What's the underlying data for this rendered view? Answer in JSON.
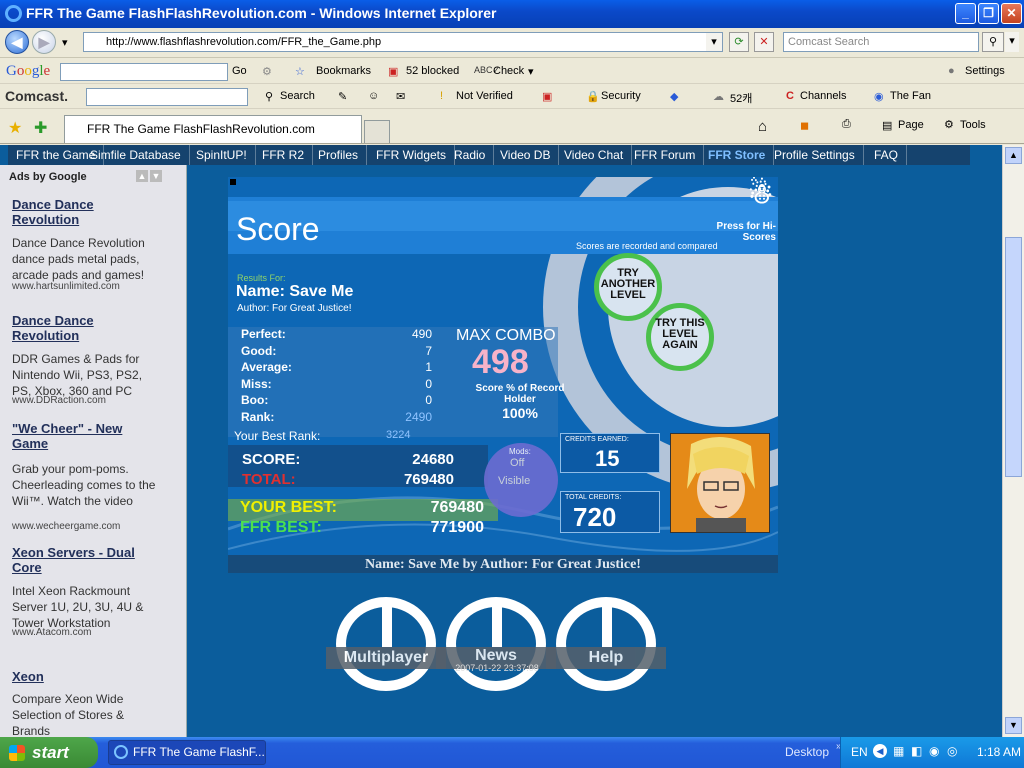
{
  "window": {
    "title": "FFR The Game FlashFlashRevolution.com - Windows Internet Explorer"
  },
  "addressbar": {
    "url": "http://www.flashflashrevolution.com/FFR_the_Game.php",
    "search_placeholder": "Comcast Search"
  },
  "google_toolbar": {
    "go_label": "Go",
    "bookmarks_label": "Bookmarks",
    "blocked_label": "52 blocked",
    "check_label": "Check",
    "settings_label": "Settings"
  },
  "comcast_toolbar": {
    "search_label": "Search",
    "verified_label": "Not Verified",
    "security_label": "Security",
    "count_label": "52캐",
    "channels_label": "Channels",
    "fan_label": "The Fan"
  },
  "tabs": {
    "active_tab": "FFR The Game FlashFlashRevolution.com",
    "page_label": "Page",
    "tools_label": "Tools"
  },
  "site_nav": [
    "FFR the Game",
    "Simfile Database",
    "SpinItUP!",
    "FFR R2",
    "Profiles",
    "FFR Widgets",
    "Radio",
    "Video DB",
    "Video Chat",
    "FFR Forum",
    "FFR Store",
    "Profile Settings",
    "FAQ"
  ],
  "ads": {
    "header": "Ads by Google",
    "items": [
      {
        "title": "Dance Dance Revolution",
        "text": "Dance Dance Revolution dance pads metal pads, arcade pads and games!",
        "url": "www.hartsunlimited.com"
      },
      {
        "title": "Dance Dance Revolution",
        "text": "DDR Games & Pads for Nintendo Wii, PS3, PS2, PS, Xbox, 360 and PC",
        "url": "www.DDRaction.com"
      },
      {
        "title": "\"We Cheer\" - New Game",
        "text": "Grab your pom-poms. Cheerleading comes to the Wii™. Watch the video",
        "url": "www.wecheergame.com"
      },
      {
        "title": "Xeon Servers - Dual Core",
        "text": "Intel Xeon Rackmount Server 1U, 2U, 3U, 4U & Tower Workstation",
        "url": "www.Atacom.com"
      },
      {
        "title": "Xeon",
        "text": "Compare Xeon Wide Selection of Stores & Brands",
        "url": ""
      }
    ]
  },
  "game": {
    "heading": "Score",
    "hiscore_text": "Press for Hi-Scores",
    "recorded_text": "Scores are recorded and compared",
    "results_for": "Results For:",
    "song_name": "Name: Save Me",
    "author": "Author: For Great Justice!",
    "try_another": "TRY ANOTHER LEVEL",
    "try_again": "TRY THIS LEVEL AGAIN",
    "stats": [
      {
        "label": "Perfect:",
        "value": "490"
      },
      {
        "label": "Good:",
        "value": "7"
      },
      {
        "label": "Average:",
        "value": "1"
      },
      {
        "label": "Miss:",
        "value": "0"
      },
      {
        "label": "Boo:",
        "value": "0"
      },
      {
        "label": "Rank:",
        "value": "2490"
      }
    ],
    "best_rank_label": "Your Best Rank:",
    "best_rank_value": "3224",
    "max_combo_label": "MAX COMBO",
    "max_combo_value": "498",
    "score_pct_label": "Score % of Record Holder",
    "score_pct_value": "100%",
    "score_label": "SCORE:",
    "score_value": "24680",
    "total_label": "TOTAL:",
    "total_value": "769480",
    "mods_label": "Mods:",
    "mods_off": "Off",
    "mods_visible": "Visible",
    "credits_earned_label": "CREDITS EARNED:",
    "credits_earned_value": "15",
    "total_credits_label": "TOTAL CREDITS:",
    "total_credits_value": "720",
    "your_best_label": "YOUR BEST:",
    "your_best_value": "769480",
    "ffr_best_label": "FFR BEST:",
    "ffr_best_value": "771900",
    "footer": "Name: Save Me by Author: For Great Justice!"
  },
  "bottom_buttons": {
    "multiplayer": "Multiplayer",
    "news": "News",
    "news_date": "2007-01-22 23:37:08",
    "help": "Help"
  },
  "taskbar": {
    "start": "start",
    "item": "FFR The Game FlashF...",
    "desktop": "Desktop",
    "lang": "EN",
    "time": "1:18 AM"
  }
}
